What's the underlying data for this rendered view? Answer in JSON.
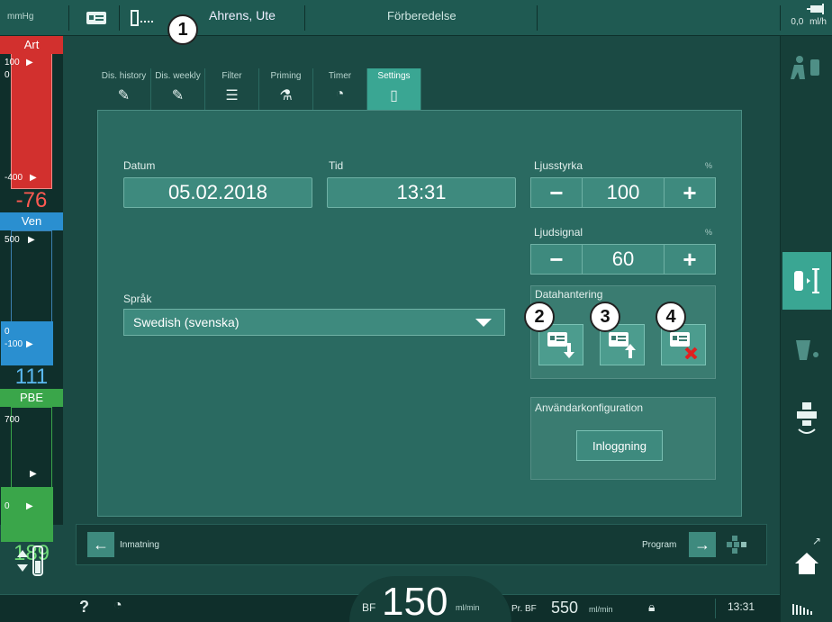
{
  "topbar": {
    "unit": "mmHg",
    "patient_name": "Ahrens, Ute",
    "phase": "Förberedelse",
    "uf_value": "0,0",
    "uf_unit": "ml/h"
  },
  "callouts": [
    "1",
    "2",
    "3",
    "4"
  ],
  "pressures": {
    "art": {
      "label": "Art",
      "top": "100",
      "bottom": "0",
      "low": "-400",
      "value": "-76",
      "color": "#d2302e"
    },
    "ven": {
      "label": "Ven",
      "top": "500",
      "bottom": "0",
      "low": "-100",
      "value": "111",
      "color": "#2a8fd0"
    },
    "pbe": {
      "label": "PBE",
      "top": "700",
      "bottom": "0",
      "value": "189",
      "color": "#3aa64a"
    }
  },
  "tabs": [
    {
      "label": "Dis. history",
      "icon": "dis-history-icon",
      "glyph": "✎"
    },
    {
      "label": "Dis. weekly",
      "icon": "dis-weekly-icon",
      "glyph": "✎"
    },
    {
      "label": "Filter",
      "icon": "filter-icon",
      "glyph": "☰"
    },
    {
      "label": "Priming",
      "icon": "priming-icon",
      "glyph": "⚗"
    },
    {
      "label": "Timer",
      "icon": "timer-icon",
      "glyph": "◔"
    },
    {
      "label": "Settings",
      "icon": "settings-icon",
      "glyph": "▯"
    }
  ],
  "settings": {
    "date_label": "Datum",
    "date_value": "05.02.2018",
    "time_label": "Tid",
    "time_value": "13:31",
    "brightness_label": "Ljusstyrka",
    "brightness_unit": "%",
    "brightness_value": "100",
    "sound_label": "Ljudsignal",
    "sound_unit": "%",
    "sound_value": "60",
    "minus": "−",
    "plus": "+",
    "language_label": "Språk",
    "language_value": "Swedish (svenska)",
    "data_label": "Datahantering",
    "user_config_label": "Användarkonfiguration",
    "login_button": "Inloggning"
  },
  "nav": {
    "back_label": "Inmatning",
    "program_label": "Program"
  },
  "status": {
    "help": "?",
    "bf_label": "BF",
    "bf_value": "150",
    "bf_unit": "ml/min",
    "prbf_label": "Pr. BF",
    "prbf_value": "550",
    "prbf_unit": "ml/min",
    "time": "13:31"
  }
}
